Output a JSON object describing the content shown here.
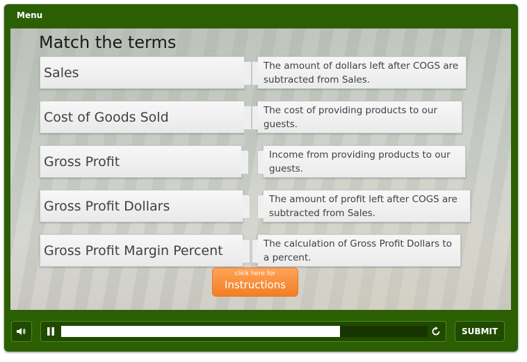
{
  "header": {
    "menu_label": "Menu"
  },
  "slide": {
    "title": "Match the terms",
    "terms": [
      "Sales",
      "Cost of Goods Sold",
      "Gross Profit",
      "Gross Profit Dollars",
      "Gross Profit Margin Percent"
    ],
    "definitions": [
      "The amount of dollars left after COGS are subtracted from Sales.",
      "The cost of providing products to our guests.",
      "Income from providing products to our guests.",
      "The amount of profit left after COGS are subtracted from Sales.",
      "The calculation of Gross Profit Dollars to a percent."
    ],
    "instructions_button": {
      "small": "click here for",
      "big": "Instructions"
    }
  },
  "controls": {
    "volume_icon": "speaker-icon",
    "pause_icon": "pause-icon",
    "replay_icon": "replay-icon",
    "progress": 0.76,
    "submit_label": "SUBMIT"
  },
  "colors": {
    "frame": "#2c5f04",
    "accent": "#f27e22"
  }
}
